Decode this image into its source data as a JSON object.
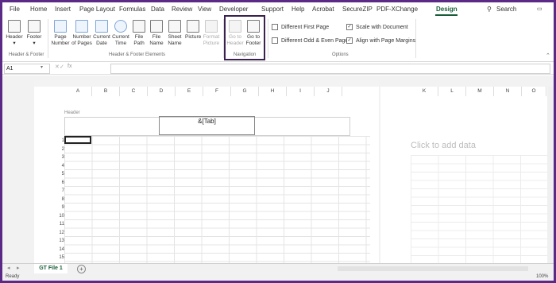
{
  "menu": {
    "tabs": [
      "File",
      "Home",
      "Insert",
      "Page Layout",
      "Formulas",
      "Data",
      "Review",
      "View",
      "Developer",
      "Support",
      "Help",
      "Acrobat",
      "SecureZIP",
      "PDF-XChange",
      "Design"
    ],
    "active_tab": "Design",
    "search_label": "Search"
  },
  "ribbon": {
    "header": "Header",
    "footer": "Footer",
    "page_number": "Page Number",
    "number_of_pages": "Number of Pages",
    "current_date": "Current Date",
    "current_time": "Current Time",
    "file_path": "File Path",
    "file_name": "File Name",
    "sheet_name": "Sheet Name",
    "picture": "Picture",
    "format_picture": "Format Picture",
    "go_to_header": "Go to Header",
    "go_to_footer": "Go to Footer",
    "group_header_footer": "Header & Footer",
    "group_elements": "Header & Footer Elements",
    "group_navigation": "Navigation",
    "group_options": "Options",
    "opt_first_page": "Different First Page",
    "opt_odd_even": "Different Odd & Even Pages",
    "opt_scale": "Scale with Document",
    "opt_align": "Align with Page Margins",
    "opt_first_page_checked": false,
    "opt_odd_even_checked": false,
    "opt_scale_checked": true,
    "opt_align_checked": true
  },
  "formula_bar": {
    "name_box": "A1",
    "fx": "fx",
    "value": ""
  },
  "sheet": {
    "columns_page1": [
      "A",
      "B",
      "C",
      "D",
      "E",
      "F",
      "G",
      "H",
      "I",
      "J"
    ],
    "columns_page2": [
      "K",
      "L",
      "M",
      "N",
      "O"
    ],
    "rows": [
      "1",
      "2",
      "3",
      "4",
      "5",
      "6",
      "7",
      "8",
      "9",
      "10",
      "11",
      "12",
      "13",
      "14",
      "15",
      "16"
    ],
    "header_label": "Header",
    "header_center": "&[Tab]",
    "click_to_add": "Click to add data"
  },
  "tabs": {
    "sheet_name": "GT File 1",
    "add_label": "+"
  },
  "status": {
    "ready": "Ready",
    "zoom": "100%"
  }
}
